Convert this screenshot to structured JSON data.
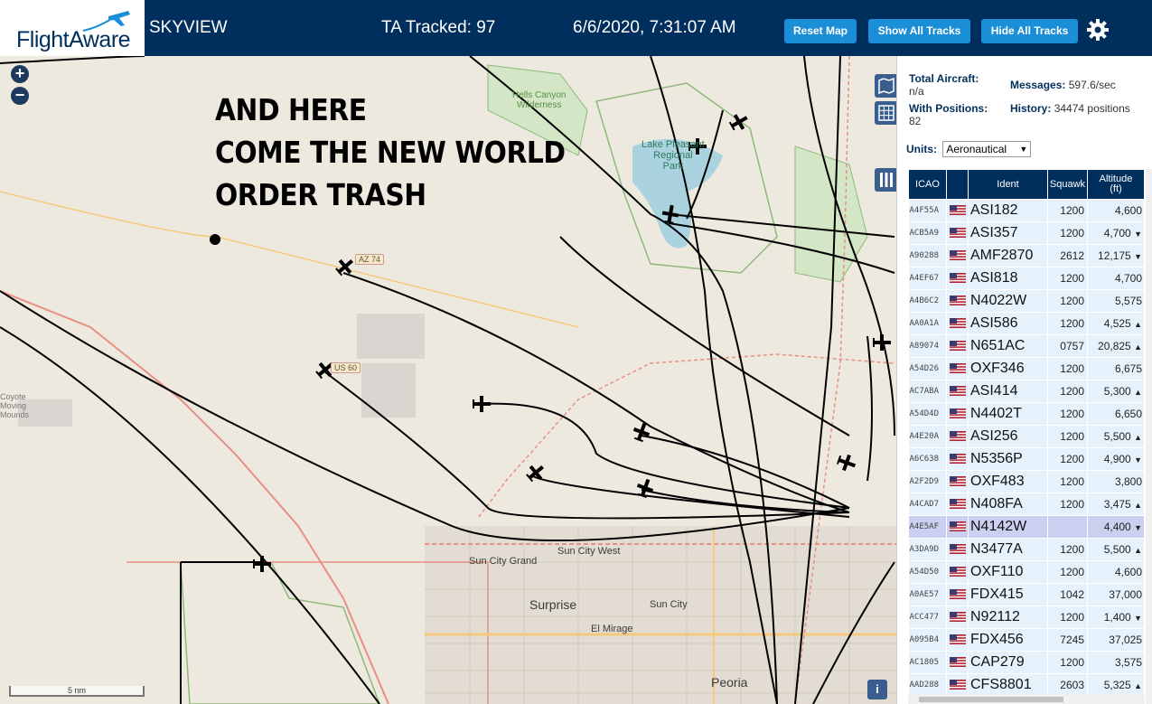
{
  "header": {
    "logo_text": "FlightAware",
    "app_name": "SKYVIEW",
    "tracked": "TA Tracked: 97",
    "datetime": "6/6/2020, 7:31:07 AM",
    "buttons": {
      "reset": "Reset Map",
      "show_all": "Show All Tracks",
      "hide_all": "Hide All Tracks"
    },
    "brand_color": "#002f5d",
    "button_color": "#1a8ed6"
  },
  "map": {
    "zoom_in": "+",
    "zoom_out": "−",
    "overlay_text": "AND HERE\nCOME THE NEW WORLD\nORDER TRASH",
    "labels": {
      "hells_canyon": "Hells Canyon\nWilderness",
      "lake_pleasant": "Lake Pleasant\nRegional\nPark",
      "sun_city_west": "Sun City West",
      "sun_city_grand": "Sun City Grand",
      "surprise": "Surprise",
      "sun_city": "Sun City",
      "el_mirage": "El Mirage",
      "peoria": "Peoria",
      "white_tank": "Coyote\nMoving\nMounds"
    },
    "shields": {
      "az74": "AZ 74",
      "us60": "US 60"
    },
    "scale": "5 nm",
    "info": "i"
  },
  "stats": {
    "total_aircraft_label": "Total Aircraft:",
    "total_aircraft_value": "n/a",
    "with_positions_label": "With Positions:",
    "with_positions_value": "82",
    "messages_label": "Messages:",
    "messages_value": "597.6/sec",
    "history_label": "History:",
    "history_value": "34474 positions",
    "units_label": "Units:",
    "units_value": "Aeronautical"
  },
  "table": {
    "headers": {
      "icao": "ICAO",
      "ident": "Ident",
      "squawk": "Squawk",
      "altitude": "Altitude\n(ft)"
    },
    "rows": [
      {
        "icao": "A4F55A",
        "ident": "ASI182",
        "squawk": "1200",
        "alt": "4,600",
        "trend": ""
      },
      {
        "icao": "ACB5A9",
        "ident": "ASI357",
        "squawk": "1200",
        "alt": "4,700",
        "trend": "▼"
      },
      {
        "icao": "A90288",
        "ident": "AMF2870",
        "squawk": "2612",
        "alt": "12,175",
        "trend": "▼"
      },
      {
        "icao": "A4EF67",
        "ident": "ASI818",
        "squawk": "1200",
        "alt": "4,700",
        "trend": ""
      },
      {
        "icao": "A4B6C2",
        "ident": "N4022W",
        "squawk": "1200",
        "alt": "5,575",
        "trend": ""
      },
      {
        "icao": "AA0A1A",
        "ident": "ASI586",
        "squawk": "1200",
        "alt": "4,525",
        "trend": "▲"
      },
      {
        "icao": "A89074",
        "ident": "N651AC",
        "squawk": "0757",
        "alt": "20,825",
        "trend": "▲"
      },
      {
        "icao": "A54D26",
        "ident": "OXF346",
        "squawk": "1200",
        "alt": "6,675",
        "trend": ""
      },
      {
        "icao": "AC7ABA",
        "ident": "ASI414",
        "squawk": "1200",
        "alt": "5,300",
        "trend": "▲"
      },
      {
        "icao": "A54D4D",
        "ident": "N4402T",
        "squawk": "1200",
        "alt": "6,650",
        "trend": ""
      },
      {
        "icao": "A4E20A",
        "ident": "ASI256",
        "squawk": "1200",
        "alt": "5,500",
        "trend": "▲"
      },
      {
        "icao": "A6C638",
        "ident": "N5356P",
        "squawk": "1200",
        "alt": "4,900",
        "trend": "▼"
      },
      {
        "icao": "A2F2D9",
        "ident": "OXF483",
        "squawk": "1200",
        "alt": "3,800",
        "trend": ""
      },
      {
        "icao": "A4CAD7",
        "ident": "N408FA",
        "squawk": "1200",
        "alt": "3,475",
        "trend": "▲"
      },
      {
        "icao": "A4E5AF",
        "ident": "N4142W",
        "squawk": "",
        "alt": "4,400",
        "trend": "▼",
        "selected": true
      },
      {
        "icao": "A3DA9D",
        "ident": "N3477A",
        "squawk": "1200",
        "alt": "5,500",
        "trend": "▲"
      },
      {
        "icao": "A54D50",
        "ident": "OXF110",
        "squawk": "1200",
        "alt": "4,600",
        "trend": ""
      },
      {
        "icao": "A0AE57",
        "ident": "FDX415",
        "squawk": "1042",
        "alt": "37,000",
        "trend": ""
      },
      {
        "icao": "ACC477",
        "ident": "N92112",
        "squawk": "1200",
        "alt": "1,400",
        "trend": "▼"
      },
      {
        "icao": "A095B4",
        "ident": "FDX456",
        "squawk": "7245",
        "alt": "37,025",
        "trend": ""
      },
      {
        "icao": "AC1805",
        "ident": "CAP279",
        "squawk": "1200",
        "alt": "3,575",
        "trend": ""
      },
      {
        "icao": "AAD288",
        "ident": "CFS8801",
        "squawk": "2603",
        "alt": "5,325",
        "trend": "▲"
      }
    ]
  }
}
